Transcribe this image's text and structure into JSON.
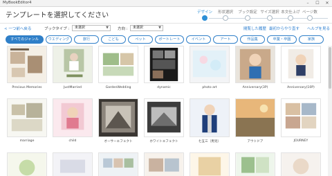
{
  "window": {
    "title": "MyBookEditor4",
    "minimize": "–",
    "maximize": "☐",
    "close": "✕"
  },
  "page_title": "テンプレートを選択してください",
  "steps": [
    {
      "label": "デザイン",
      "active": true
    },
    {
      "label": "形状選択",
      "active": false
    },
    {
      "label": "ブック設定",
      "active": false
    },
    {
      "label": "サイズ選択",
      "active": false
    },
    {
      "label": "本文仕上げ",
      "active": false
    },
    {
      "label": "ページ数",
      "active": false
    }
  ],
  "toolbar": {
    "back_link": "< 一つ前へ戻る",
    "book_type_label": "ブックタイプ :",
    "book_type_value": "未選択",
    "orientation_label": "方向 :",
    "orientation_value": "未選択",
    "history_link": "閲覧した履歴",
    "start_over_link": "最初からやり直す",
    "help_link": "ヘルプを見る"
  },
  "genre_tabs": [
    {
      "label": "すべてのジャンル",
      "active": true
    },
    {
      "label": "ウエディング",
      "active": false
    },
    {
      "label": "旅行",
      "active": false
    },
    {
      "label": "こども",
      "active": false
    },
    {
      "label": "ペット",
      "active": false
    },
    {
      "label": "ポートレート",
      "active": false
    },
    {
      "label": "イベント",
      "active": false
    },
    {
      "label": "アート",
      "active": false
    },
    {
      "label": "作品集",
      "active": false
    },
    {
      "label": "卒業・卒園",
      "active": false
    },
    {
      "label": "家族",
      "active": false
    }
  ],
  "templates_row1": [
    {
      "name": "Precious Memories",
      "icon": "precious-memories-thumbnail"
    },
    {
      "name": "JustMarried",
      "icon": "just-married-thumbnail"
    },
    {
      "name": "GardenWedding",
      "icon": "garden-wedding-thumbnail"
    },
    {
      "name": "dynamic",
      "icon": "dynamic-thumbnail"
    },
    {
      "name": "photo art",
      "icon": "photo-art-thumbnail"
    },
    {
      "name": "Anniversary(3P)",
      "icon": "anniversary-3p-thumbnail"
    },
    {
      "name": "Anniversary(10P)",
      "icon": "anniversary-10p-thumbnail"
    }
  ],
  "templates_row2": [
    {
      "name": "marriage",
      "icon": "marriage-thumbnail"
    },
    {
      "name": "child",
      "icon": "child-thumbnail"
    },
    {
      "name": "オーサーエフェクト",
      "icon": "sepia-effect-thumbnail"
    },
    {
      "name": "ホワイトエフェクト",
      "icon": "white-effect-thumbnail"
    },
    {
      "name": "七五三（男児）",
      "icon": "shichigosan-boy-thumbnail"
    },
    {
      "name": "アウトドア",
      "icon": "outdoor-thumbnail"
    },
    {
      "name": "JOURNEY",
      "icon": "journey-thumbnail"
    }
  ],
  "colors": {
    "accent": "#2f7fc8",
    "step_active": "#2d8fd6",
    "link": "#2d7fd0"
  }
}
